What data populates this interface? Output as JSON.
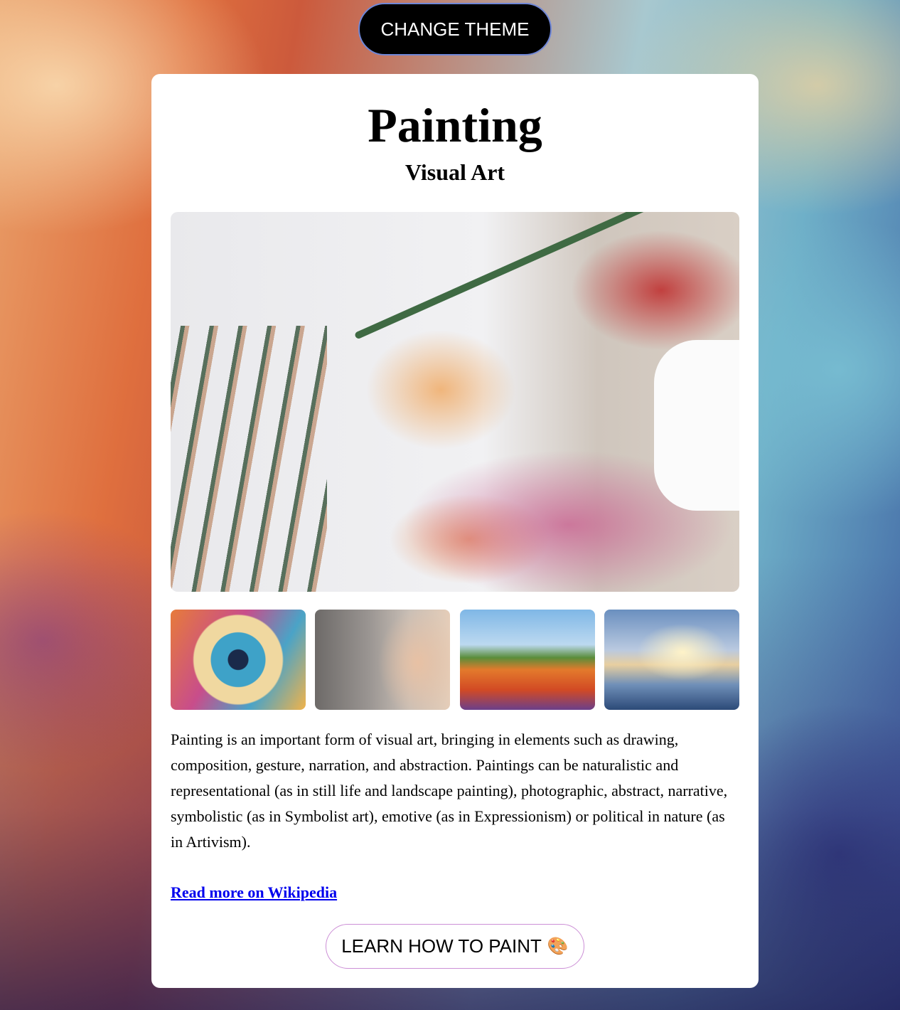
{
  "header": {
    "theme_button_label": "CHANGE THEME"
  },
  "card": {
    "title": "Painting",
    "subtitle": "Visual Art",
    "hero_image": {
      "icon": "painting-palette-photo"
    },
    "thumbnails": [
      {
        "name": "eye-painting-thumbnail"
      },
      {
        "name": "portrait-painting-thumbnail"
      },
      {
        "name": "poppy-field-painting-thumbnail"
      },
      {
        "name": "sailboat-painting-thumbnail"
      }
    ],
    "description": "Painting is an important form of visual art, bringing in elements such as drawing, composition, gesture, narration, and abstraction. Paintings can be naturalistic and representational (as in still life and landscape painting), photographic, abstract, narrative, symbolistic (as in Symbolist art), emotive (as in Expressionism) or political in nature (as in Artivism).",
    "link_label": "Read more on Wikipedia",
    "learn_button_label": "LEARN HOW TO PAINT",
    "learn_button_icon": "🎨"
  },
  "colors": {
    "theme_button_bg": "#000000",
    "link": "#0000ee",
    "learn_button_border": "#cc8fd6"
  }
}
